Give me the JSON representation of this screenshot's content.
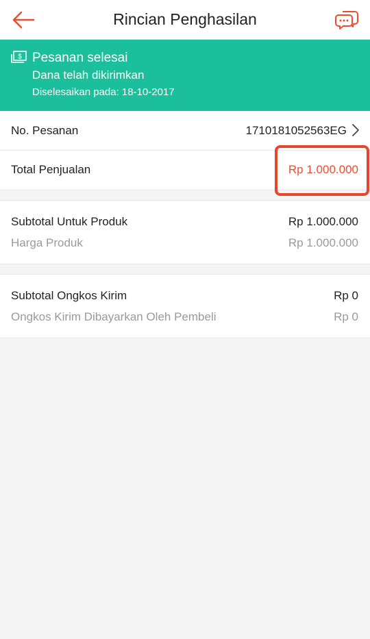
{
  "header": {
    "title": "Rincian Penghasilan",
    "back_icon": "arrow-left-icon",
    "chat_icon": "chat-bubbles-icon",
    "accent_color": "#ee4d2d"
  },
  "banner": {
    "icon": "money-icon",
    "title": "Pesanan selesai",
    "subtitle": "Dana telah dikirimkan",
    "date_text": "Diselesaikan pada: 18-10-2017",
    "background_color": "#1cbf9c"
  },
  "order": {
    "label": "No. Pesanan",
    "value": "1710181052563EG"
  },
  "total": {
    "label": "Total Penjualan",
    "value": "Rp 1.000.000"
  },
  "product": {
    "subtotal_label": "Subtotal Untuk Produk",
    "subtotal_value": "Rp 1.000.000",
    "price_label": "Harga Produk",
    "price_value": "Rp 1.000.000"
  },
  "shipping": {
    "subtotal_label": "Subtotal Ongkos Kirim",
    "subtotal_value": "Rp 0",
    "buyer_paid_label": "Ongkos Kirim Dibayarkan Oleh Pembeli",
    "buyer_paid_value": "Rp 0"
  }
}
